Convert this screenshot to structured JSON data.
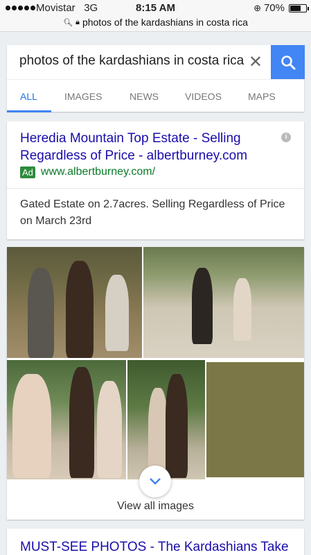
{
  "status_bar": {
    "carrier": "Movistar",
    "network": "3G",
    "time": "8:15 AM",
    "battery": "70%",
    "battery_level": 0.7
  },
  "url_bar": {
    "address": "photos of the kardashians in costa rica"
  },
  "search": {
    "query": "photos of the kardashians in costa rica",
    "clear_icon": "close-icon",
    "search_icon": "search-icon"
  },
  "tabs": [
    {
      "label": "ALL",
      "active": true
    },
    {
      "label": "IMAGES",
      "active": false
    },
    {
      "label": "NEWS",
      "active": false
    },
    {
      "label": "VIDEOS",
      "active": false
    },
    {
      "label": "MAPS",
      "active": false
    }
  ],
  "ad": {
    "title": "Heredia Mountain Top Estate - Selling Regardless of Price - albertburney.com",
    "badge": "Ad",
    "url": "www.albertburney.com/",
    "description": "Gated Estate on 2.7acres. Selling Regardless of Price on March 23rd"
  },
  "images": {
    "view_all_label": "View all images",
    "expand_icon": "chevron-down-icon"
  },
  "next_result": {
    "title": "MUST-SEE PHOTOS - The Kardashians Take"
  },
  "colors": {
    "accent": "#4285f4",
    "link": "#1a0dab",
    "ad_green": "#2e8b3d"
  }
}
